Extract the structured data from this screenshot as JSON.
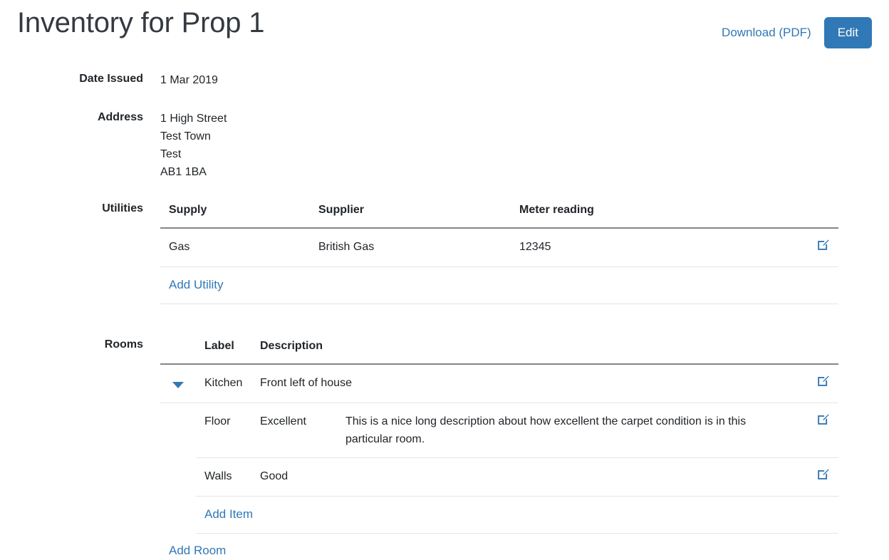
{
  "header": {
    "title": "Inventory for Prop 1",
    "download_label": "Download (PDF)",
    "edit_label": "Edit"
  },
  "colors": {
    "accent": "#3178b6",
    "link": "#3178b6",
    "text": "#212529",
    "title": "#343a40",
    "header_border": "#83878b",
    "row_border": "#e3e5e7"
  },
  "fields": {
    "date_issued_label": "Date Issued",
    "date_issued_value": "1 Mar 2019",
    "address_label": "Address",
    "address_lines": [
      "1 High Street",
      "Test Town",
      "Test",
      "AB1 1BA"
    ],
    "utilities_label": "Utilities",
    "rooms_label": "Rooms"
  },
  "utilities": {
    "columns": [
      "Supply",
      "Supplier",
      "Meter reading"
    ],
    "rows": [
      {
        "supply": "Gas",
        "supplier": "British Gas",
        "meter_reading": "12345",
        "edit_icon": "edit-square-icon"
      }
    ],
    "add_label": "Add Utility"
  },
  "rooms": {
    "columns": [
      "Label",
      "Description"
    ],
    "rows": [
      {
        "toggle_icon": "caret-down-icon",
        "expanded": true,
        "label": "Kitchen",
        "description": "Front left of house",
        "edit_icon": "edit-square-icon",
        "items": [
          {
            "label": "Floor",
            "condition": "Excellent",
            "description": "This is a nice long description about how excellent the carpet condition is in this particular room.",
            "edit_icon": "edit-square-icon"
          },
          {
            "label": "Walls",
            "condition": "Good",
            "description": "",
            "edit_icon": "edit-square-icon"
          }
        ],
        "add_item_label": "Add Item"
      }
    ],
    "add_label": "Add Room"
  }
}
